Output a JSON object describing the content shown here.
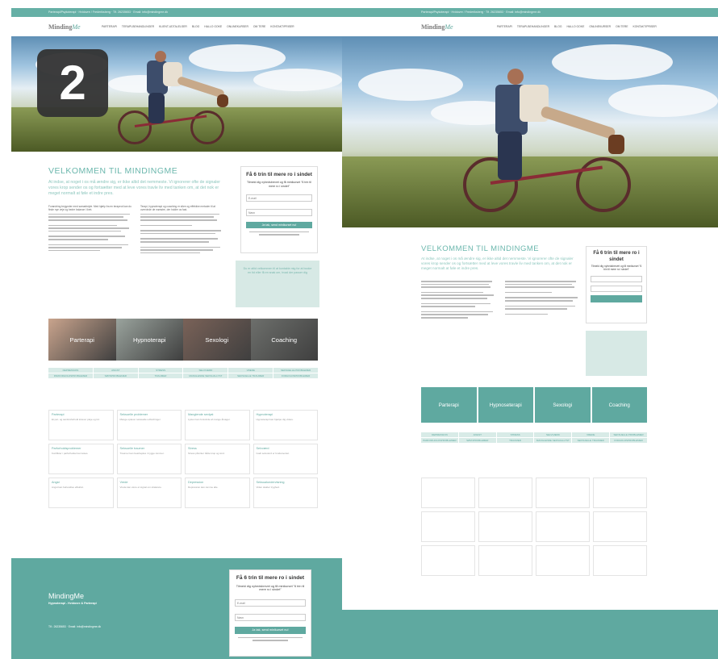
{
  "site": {
    "topbar": "Parterapi/Psykoterapi · Hvidovre / Frederiksberg · Tlf. 26235653 · Email: info@mindingme.dk",
    "logo_main": "Minding",
    "logo_tail": "Me",
    "nav_left": [
      "PARTERAPI",
      "TERAPI-BEHANDLINGER",
      "KLIENT-UDTALELSER",
      "BLOG",
      "HALLO GOKE",
      "ONLINEKURSER",
      "OM TERE",
      "KONTAKT/PRISER"
    ],
    "nav_right": [
      "PARTERAPI",
      "TERAPI-BEHANDLINGER",
      "BLOG",
      "HALLO GOKE",
      "ONLINEKURSER",
      "OM TERE",
      "KONTAKT/PRISER"
    ]
  },
  "left": {
    "badge": "2",
    "welcome": "VELKOMMEN TIL MINDINGME",
    "lead": "At indse, at noget i os må ændre sig, er ikke altid det nemmeste. Vi ignorerer ofte de signaler vores krop sender os og fortsætter med at leve vores travle liv med tanken om, at det nok er meget normalt at føle et indre pres.",
    "col1": "Forandring begynder med samarbejde. Med hjælp fra en terapeut kan du finde nye veje og bedre balance i livet.",
    "col2": "Terapi, hypnoterapi og coaching er sikre og effektive metoder til at overvinde de mønstre, der holder os fast.",
    "tiles": [
      "Parterapi",
      "Hypnoterapi",
      "Sexologi",
      "Coaching"
    ],
    "tags": [
      "DEPRESSION",
      "ANGST",
      "STRESS",
      "SELVVÆRD",
      "VREDE",
      "SEKSUELLE PROBLEMER",
      "PARFORHOLDSPROBLEMER",
      "SØVNPROBLEMER",
      "TRAUMER",
      "MANGLENDE SEKSUALLYST",
      "SEKSUELLE TRAUMER",
      "FORHOLDSPROBLEMER"
    ],
    "cards": [
      {
        "t": "Parterapi",
        "d": "Et par- og samlivsforhold kræver pleje og tid."
      },
      {
        "t": "Seksuelle problemer",
        "d": "Mange oplever seksuelle udfordringer."
      },
      {
        "t": "Manglende sexlyst",
        "d": "Lysten kan forsvinde af mange årsager."
      },
      {
        "t": "Hypnoterapi",
        "d": "Hypnoterapi kan hjælpe dig videre."
      },
      {
        "t": "Parforholdsproblemer",
        "d": "Konflikter i parforholdet kan løses."
      },
      {
        "t": "Seksuelle traumer",
        "d": "Traumer kan bearbejdes i trygge rammer."
      },
      {
        "t": "Stress",
        "d": "Stress påvirker både krop og sind."
      },
      {
        "t": "Selvværd",
        "d": "Godt selvværd er fundamentet."
      },
      {
        "t": "Angst",
        "d": "Angst kan behandles effektivt."
      },
      {
        "t": "Vrede",
        "d": "Vrede kan være et signal om ubalance."
      },
      {
        "t": "Depression",
        "d": "Depression kan ramme alle."
      },
      {
        "t": "Seksualundervisning",
        "d": "Viden skaber tryghed."
      }
    ],
    "form_title": "Få 6 trin til mere ro i sindet",
    "form_sub": "Tilmeld dig nyhedsbrevet og få minikurset \"6 trin til mere ro i sindet\"",
    "email_placeholder": "E-mail",
    "name_placeholder": "Navn",
    "form_button": "Ja tak, send minikurset nu!",
    "side_note": "Du er altid velkommen til at kontakte mig for at booke en tid eller få en snak om, hvad der passer dig",
    "footer_brand": "MindingMe",
    "footer_line1": "Hypnoterapi - Hvidovre & Parterapi",
    "footer_line2": "Tlf.: 26235653 · Email: info@mindingme.dk",
    "footer_form_title": "Få 6 trin til mere ro i sindet",
    "footer_form_sub": "Tilmeld dig nyhedsbrevet og få minikurset \"6 trin til mere ro i sindet\"",
    "footer_email": "E-mail",
    "footer_name": "Navn",
    "footer_button": "Ja tak, send minikurset nu!"
  },
  "right": {
    "welcome": "VELKOMMEN TIL MINDINGME",
    "lead": "At indse, at noget i os må ændre sig, er ikke altid det nemmeste. Vi ignorerer ofte de signaler vores krop sender os og fortsætter med at leve vores travle liv med tanken om, at det nok er meget normalt at føle et indre pres.",
    "form_title": "Få 6 trin til mere ro i sindet",
    "form_sub": "Tilmeld dig nyhedsbrevet og få minikurset \"6 trin til mere ro i sindet\"",
    "tiles": [
      "Parterapi",
      "Hypnoseterapi",
      "Sexologi",
      "Coaching"
    ],
    "tags": [
      "DEPRESSION",
      "ANGST",
      "STRESS",
      "SELVVÆRD",
      "VREDE",
      "SEKSUELLE PROBLEMER",
      "PARFORHOLDSPROBLEMER",
      "SØVNPROBLEMER",
      "TRAUMER",
      "MANGLENDE SEKSUALLYST",
      "SEKSUELLE TRAUMER",
      "FORHOLDSPROBLEMER"
    ]
  }
}
